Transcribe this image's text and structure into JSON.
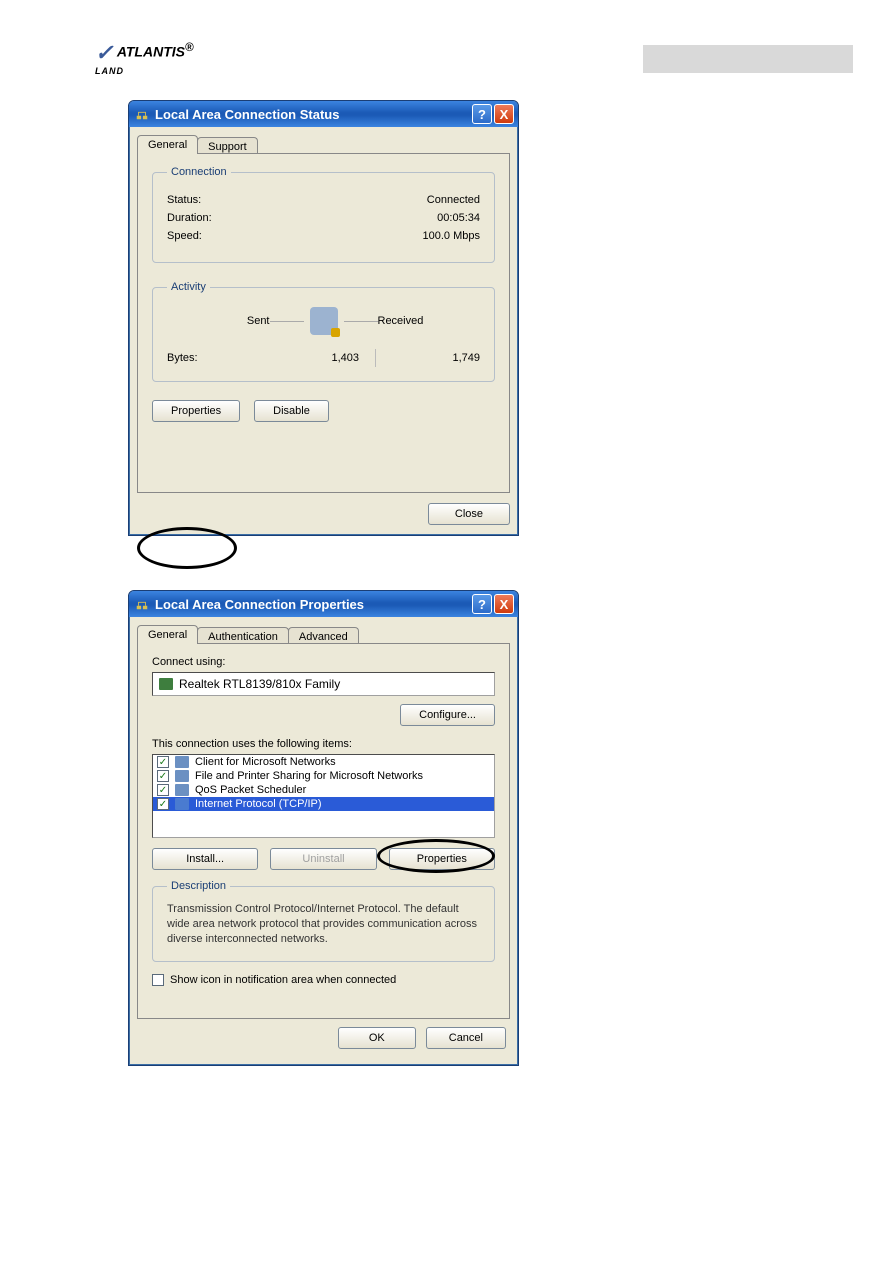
{
  "brand": {
    "name": "ATLANTIS",
    "sub": "LAND"
  },
  "dialog1": {
    "title": "Local Area Connection Status",
    "tabs": {
      "general": "General",
      "support": "Support"
    },
    "connection": {
      "legend": "Connection",
      "status_label": "Status:",
      "status_value": "Connected",
      "duration_label": "Duration:",
      "duration_value": "00:05:34",
      "speed_label": "Speed:",
      "speed_value": "100.0 Mbps"
    },
    "activity": {
      "legend": "Activity",
      "sent_label": "Sent",
      "received_label": "Received",
      "bytes_label": "Bytes:",
      "sent_value": "1,403",
      "received_value": "1,749"
    },
    "buttons": {
      "properties": "Properties",
      "disable": "Disable",
      "close": "Close"
    }
  },
  "dialog2": {
    "title": "Local Area Connection Properties",
    "tabs": {
      "general": "General",
      "authentication": "Authentication",
      "advanced": "Advanced"
    },
    "connect_using_label": "Connect using:",
    "adapter": "Realtek RTL8139/810x Family",
    "configure": "Configure...",
    "items_label": "This connection uses the following items:",
    "items": [
      {
        "label": "Client for Microsoft Networks",
        "checked": true,
        "selected": false
      },
      {
        "label": "File and Printer Sharing for Microsoft Networks",
        "checked": true,
        "selected": false
      },
      {
        "label": "QoS Packet Scheduler",
        "checked": true,
        "selected": false
      },
      {
        "label": "Internet Protocol (TCP/IP)",
        "checked": true,
        "selected": true
      }
    ],
    "buttons": {
      "install": "Install...",
      "uninstall": "Uninstall",
      "properties": "Properties"
    },
    "description": {
      "legend": "Description",
      "text": "Transmission Control Protocol/Internet Protocol. The default wide area network protocol that provides communication across diverse interconnected networks."
    },
    "show_icon": "Show icon in notification area when connected",
    "ok": "OK",
    "cancel": "Cancel"
  },
  "titlebar_buttons": {
    "help": "?",
    "close": "X"
  }
}
